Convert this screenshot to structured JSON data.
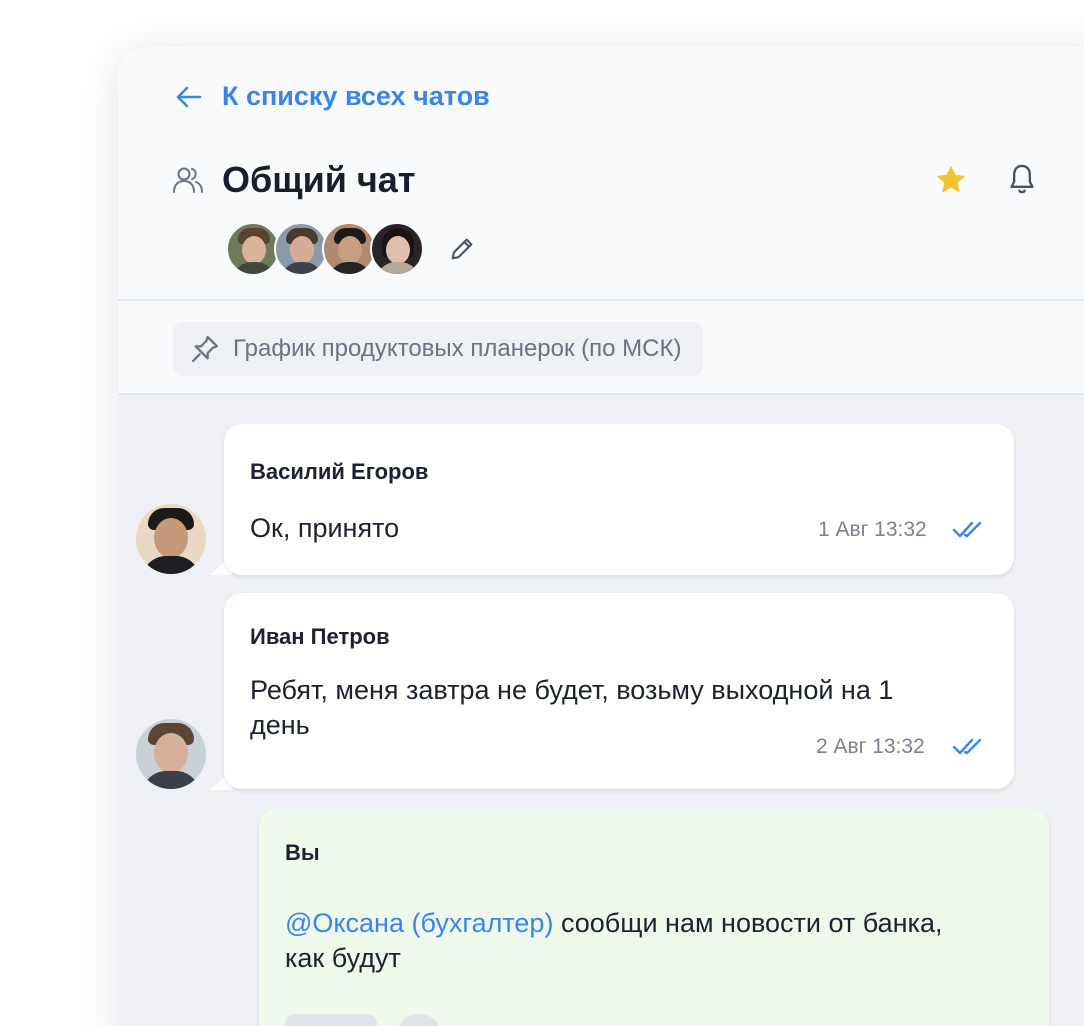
{
  "header": {
    "back_label": "К списку всех чатов",
    "chat_title": "Общий чат"
  },
  "pinned": {
    "label": "График продуктовых планерок (по МСК)"
  },
  "messages": [
    {
      "author": "Василий Егоров",
      "text": "Ок, принято",
      "time": "1 Авг 13:32"
    },
    {
      "author": "Иван Петров",
      "text_line1": "Ребят, меня завтра не будет, возьму выходной на 1",
      "text_line2": "день",
      "time": "2 Авг 13:32"
    },
    {
      "author": "Вы",
      "mention": "@Оксана (бухгалтер)",
      "text_line1": " сообщи нам новости от банка,",
      "text_line2": "как будут"
    }
  ],
  "colors": {
    "accent": "#3a86e8",
    "star": "#f2c230",
    "own_bubble": "#eef8eb",
    "background": "#eef0f5"
  }
}
